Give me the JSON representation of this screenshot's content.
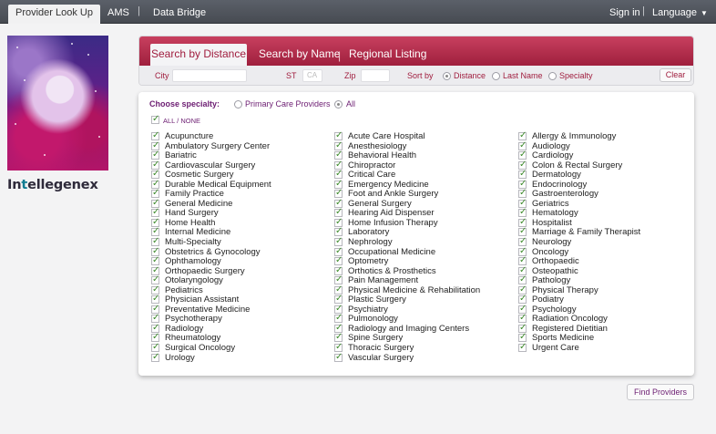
{
  "topnav": {
    "tabs": [
      "Provider Look Up",
      "AMS",
      "Data Bridge"
    ],
    "sign_in": "Sign in",
    "language": "Language"
  },
  "logo": {
    "prefix": "In",
    "hl": "t",
    "suffix": "ellegenex"
  },
  "search": {
    "tabs": [
      "Search by Distance",
      "Search by Name",
      "Regional Listing"
    ],
    "city_label": "City",
    "st_label": "ST",
    "st_placeholder": "CA",
    "zip_label": "Zip",
    "sort_label": "Sort by",
    "sort_options": [
      "Distance",
      "Last Name",
      "Specialty"
    ],
    "sort_selected": "Distance",
    "clear_label": "Clear"
  },
  "specialty": {
    "choose_label": "Choose specialty:",
    "filters": [
      "Primary Care Providers",
      "All"
    ],
    "filter_selected": "All",
    "all_none": "ALL / NONE",
    "columns": [
      [
        "Acupuncture",
        "Ambulatory Surgery Center",
        "Bariatric",
        "Cardiovascular Surgery",
        "Cosmetic Surgery",
        "Durable Medical Equipment",
        "Family Practice",
        "General Medicine",
        "Hand Surgery",
        "Home Health",
        "Internal Medicine",
        "Multi-Specialty",
        "Obstetrics & Gynocology",
        "Ophthamology",
        "Orthopaedic Surgery",
        "Otolaryngology",
        "Pediatrics",
        "Physician Assistant",
        "Preventative Medicine",
        "Psychotherapy",
        "Radiology",
        "Rheumatology",
        "Surgical Oncology",
        "Urology"
      ],
      [
        "Acute Care Hospital",
        "Anesthesiology",
        "Behavioral Health",
        "Chiropractor",
        "Critical Care",
        "Emergency Medicine",
        "Foot and Ankle Surgery",
        "General Surgery",
        "Hearing Aid Dispenser",
        "Home Infusion Therapy",
        "Laboratory",
        "Nephrology",
        "Occupational Medicine",
        "Optometry",
        "Orthotics & Prosthetics",
        "Pain Management",
        "Physical Medicine & Rehabilitation",
        "Plastic Surgery",
        "Psychiatry",
        "Pulmonology",
        "Radiology and Imaging Centers",
        "Spine Surgery",
        "Thoracic Surgery",
        "Vascular Surgery"
      ],
      [
        "Allergy & Immunology",
        "Audiology",
        "Cardiology",
        "Colon & Rectal Surgery",
        "Dermatology",
        "Endocrinology",
        "Gastroenterology",
        "Geriatrics",
        "Hematology",
        "Hospitalist",
        "Marriage & Family Therapist",
        "Neurology",
        "Oncology",
        "Orthopaedic",
        "Osteopathic",
        "Pathology",
        "Physical Therapy",
        "Podiatry",
        "Psychology",
        "Radiation Oncology",
        "Registered Dietitian",
        "Sports Medicine",
        "Urgent Care"
      ]
    ]
  },
  "find_label": "Find Providers"
}
